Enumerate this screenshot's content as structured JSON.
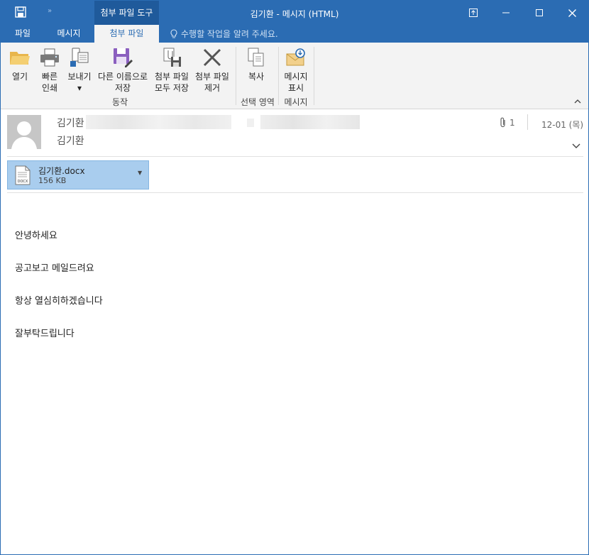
{
  "titlebar": {
    "context_tab_title": "첨부 파일 도구",
    "window_title": "김기환 - 메시지 (HTML)",
    "more_glyph": "»"
  },
  "tabs": {
    "file": "파일",
    "message": "메시지",
    "attachments": "첨부 파일",
    "tell_me": "수행할 작업을 알려 주세요."
  },
  "ribbon": {
    "buttons": [
      {
        "label": "열기",
        "icon": "open-folder-icon"
      },
      {
        "label": "빠른\n인쇄",
        "icon": "printer-icon"
      },
      {
        "label": "보내기\n▾",
        "icon": "send-to-icon"
      },
      {
        "label": "다른 이름으로\n저장",
        "icon": "save-as-icon"
      },
      {
        "label": "첨부 파일\n모두 저장",
        "icon": "save-all-icon"
      },
      {
        "label": "첨부 파일\n제거",
        "icon": "remove-icon"
      },
      {
        "label": "복사",
        "icon": "copy-icon"
      },
      {
        "label": "메시지\n표시",
        "icon": "show-message-icon"
      }
    ],
    "groups": {
      "actions": "동작",
      "selection": "선택 영역",
      "message": "메시지"
    }
  },
  "header": {
    "from_name": "김기환",
    "to_name": "김기환",
    "attachment_count": "1",
    "date": "12-01 (목)"
  },
  "attachment": {
    "filename": "김기환.docx",
    "size": "156 KB",
    "type_label": "DOCX"
  },
  "body": {
    "lines": [
      "안녕하세요",
      "공고보고 메일드려요",
      "항상 열심히하겠습니다",
      "잘부탁드립니다"
    ]
  },
  "colors": {
    "accent": "#2b6cb3",
    "attachment_chip": "#a9cdee",
    "ribbon_bg": "#f3f3f3"
  }
}
